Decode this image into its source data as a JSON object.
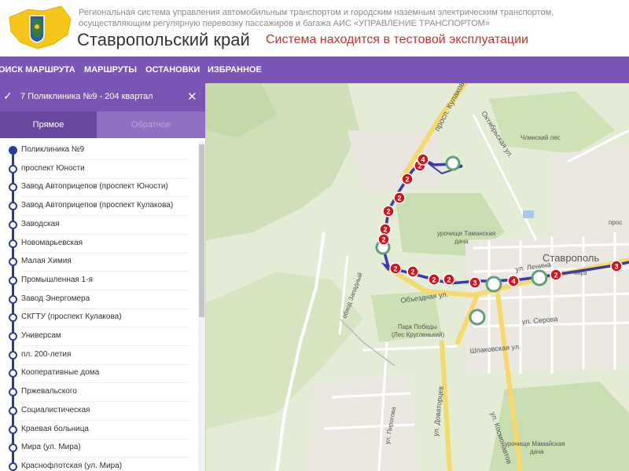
{
  "header": {
    "subtitle_line1": "Региональная система управления автомобильным транспортом и городским наземным электрическим транспортом,",
    "subtitle_line2": "осуществляющим регулярную перевозку пассажиров и багажа АИС «УПРАВЛЕНИЕ ТРАНСПОРТОМ»",
    "region": "Ставропольский край",
    "test_notice": "Система находится в тестовой эксплуатации",
    "logo_icon": "stavropol-coat-of-arms-icon"
  },
  "nav": {
    "items": [
      "оиск маршрута",
      "Маршруты",
      "Остановки",
      "Избранное"
    ]
  },
  "route": {
    "name": "7 Поликлиника №9 - 204 квартал",
    "check_icon": "check-icon",
    "close_icon": "close-icon",
    "tab_forward": "Прямое",
    "tab_back": "Обратное"
  },
  "stops": [
    "Поликлиника №9",
    "проспект Юности",
    "Завод Автоприцепов (проспект Юности)",
    "Завод Автоприцепов (проспект Кулакова)",
    "Заводская",
    "Новомарьевская",
    "Малая Химия",
    "Промышленная 1-я",
    "Завод Энергомера",
    "СКГТУ (проспект Кулакова)",
    "Универсам",
    "пл. 200-летия",
    "Кооперативные дома",
    "Пржевальского",
    "Социалистическая",
    "Краевая больница",
    "Мира (ул. Мира)",
    "Краснофлотская (ул. Мира)"
  ],
  "map": {
    "labels": {
      "prosp_kulakova": "просп. Кулакова",
      "oktyabrskaya": "Октябрьская ул.",
      "chlinsky_les": "Члинский лес",
      "tamanskaya_1": "урочище Таманская",
      "tamanskaya_2": "дача",
      "stavropol": "Ставрополь",
      "ul_lenina": "ул. Ленина",
      "obezdnaya": "Объездная ул.",
      "obkhod_zapadny": "обход Западный",
      "park_pobedy_1": "Парк Победы",
      "park_pobedy_2": "(Лес Кругленький)",
      "ul_serova": "ул. Серова",
      "shpakovskaya": "Шпаковская ул.",
      "ul_pirogova": "ул. Пирогова",
      "ul_dovatortsev": "ул. Доваторцев",
      "ul_kosmonavtov": "ул. Космонавтов",
      "mamayskaya_1": "урочище Мамайская",
      "mamayskaya_2": "дача",
      "prosp_cut": "прос",
      "mira_cut": "мира"
    },
    "colors": {
      "route_line": "#3a3ab0",
      "cluster_fill": "#d4141c",
      "stop_ring": "#5fa07a",
      "nav_purple": "#7a55b5",
      "road_yellow": "#f6d86b"
    },
    "clusters": [
      "2",
      "2",
      "4",
      "2",
      "2",
      "2",
      "2",
      "2",
      "2",
      "2",
      "2",
      "3",
      "4",
      "2",
      "3"
    ]
  }
}
